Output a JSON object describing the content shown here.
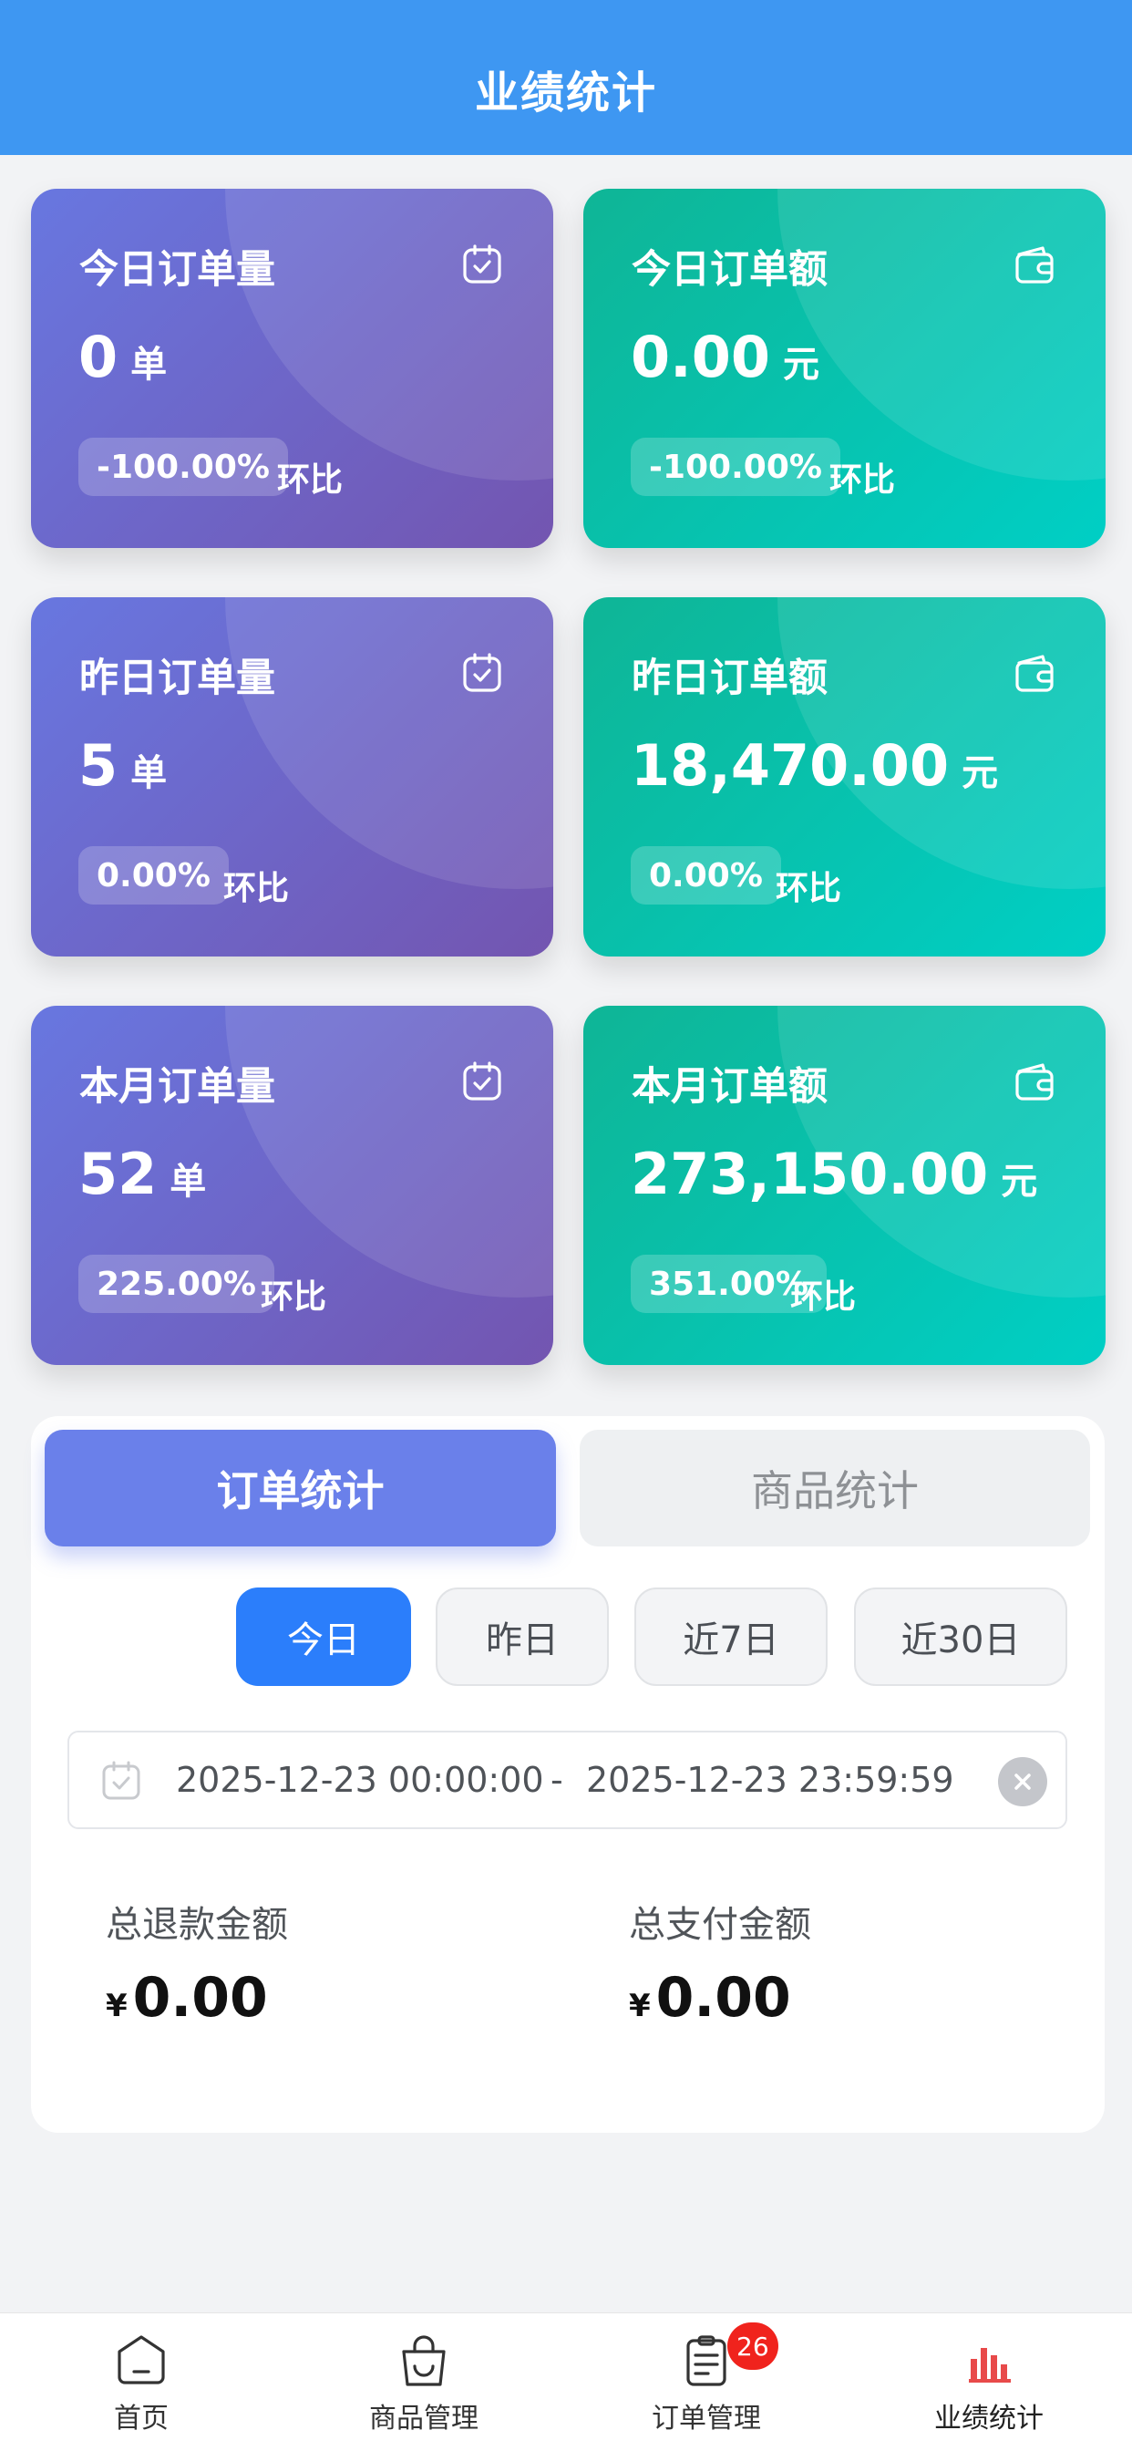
{
  "header": {
    "title": "业绩统计"
  },
  "cards": [
    {
      "title": "今日订单量",
      "value": "0",
      "unit": "单",
      "ratio": "-100.00%",
      "ratio_label": "环比",
      "icon": "calendar-check-icon"
    },
    {
      "title": "今日订单额",
      "value": "0.00",
      "unit": "元",
      "ratio": "-100.00%",
      "ratio_label": "环比",
      "icon": "wallet-icon"
    },
    {
      "title": "昨日订单量",
      "value": "5",
      "unit": "单",
      "ratio": "0.00%",
      "ratio_label": "环比",
      "icon": "calendar-check-icon"
    },
    {
      "title": "昨日订单额",
      "value": "18,470.00",
      "unit": "元",
      "ratio": "0.00%",
      "ratio_label": "环比",
      "icon": "wallet-icon"
    },
    {
      "title": "本月订单量",
      "value": "52",
      "unit": "单",
      "ratio": "225.00%",
      "ratio_label": "环比",
      "icon": "calendar-check-icon"
    },
    {
      "title": "本月订单额",
      "value": "273,150.00",
      "unit": "元",
      "ratio": "351.00%",
      "ratio_label": "环比",
      "icon": "wallet-icon"
    }
  ],
  "stats_panel": {
    "tabs": [
      "订单统计",
      "商品统计"
    ],
    "active_tab": "订单统计",
    "ranges": [
      "今日",
      "昨日",
      "近7日",
      "近30日"
    ],
    "active_range": "今日",
    "date_start": "2025-12-23 00:00:00",
    "date_separator": "-",
    "date_end": "2025-12-23 23:59:59",
    "refund_label": "总退款金额",
    "refund_currency": "¥",
    "refund_value": "0.00",
    "pay_label": "总支付金额",
    "pay_currency": "¥",
    "pay_value": "0.00"
  },
  "tabbar": {
    "items": [
      {
        "label": "首页",
        "icon": "home-icon"
      },
      {
        "label": "商品管理",
        "icon": "shopping-bag-icon"
      },
      {
        "label": "订单管理",
        "icon": "order-list-icon",
        "badge": "26"
      },
      {
        "label": "业绩统计",
        "icon": "bar-chart-icon",
        "active": true
      }
    ]
  },
  "colors": {
    "header": "#3e97f2",
    "card_purple": "#6f66cc",
    "card_teal": "#00c2ad",
    "accent_blue": "#2b7efb",
    "active_tab_icon": "#e84a4a",
    "badge": "#f0231d"
  }
}
